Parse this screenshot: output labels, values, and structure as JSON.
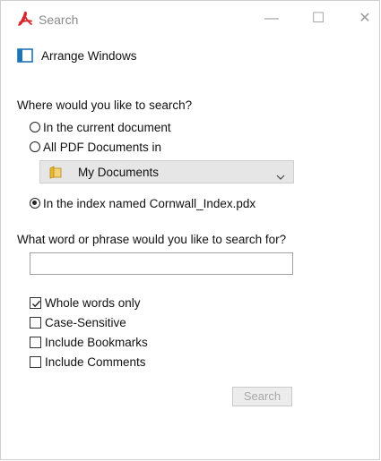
{
  "window": {
    "title": "Search",
    "minimize_glyph": "—",
    "maximize_glyph": "☐",
    "close_glyph": "✕"
  },
  "arrange_windows": {
    "label": "Arrange Windows",
    "icon": "arrange-windows-icon"
  },
  "location": {
    "question": "Where would you like to search?",
    "options": [
      {
        "label": "In the current document",
        "checked": false
      },
      {
        "label": "All PDF Documents in",
        "checked": false
      },
      {
        "label": "In the index named Cornwall_Index.pdx",
        "checked": true
      }
    ],
    "folder_select": {
      "value": "My Documents",
      "icon": "folder-icon"
    }
  },
  "query": {
    "question": "What word or phrase would you like to search for?",
    "value": ""
  },
  "options": [
    {
      "label": "Whole words only",
      "checked": true
    },
    {
      "label": "Case-Sensitive",
      "checked": false
    },
    {
      "label": "Include Bookmarks",
      "checked": false
    },
    {
      "label": "Include Comments",
      "checked": false
    }
  ],
  "search_button": {
    "label": "Search",
    "enabled": false
  },
  "colors": {
    "pdf_red": "#d9272e",
    "arrange_blue": "#1f73b7",
    "folder_yellow": "#e8b730"
  }
}
